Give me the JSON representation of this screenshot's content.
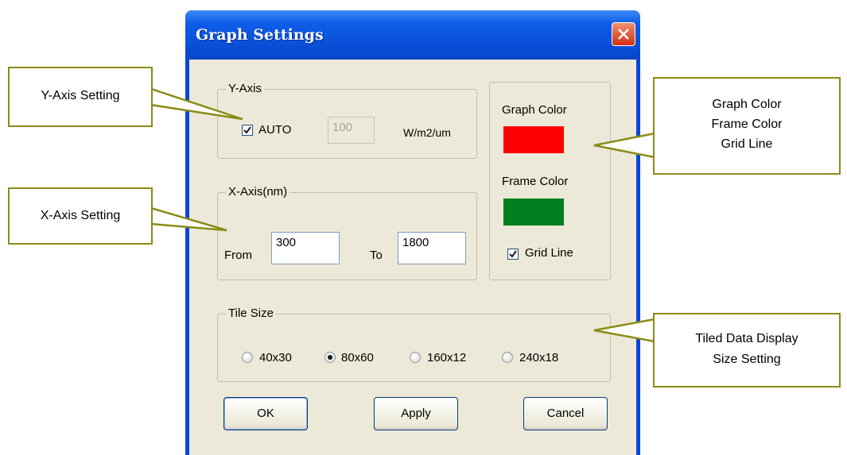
{
  "dialog": {
    "title": "Graph Settings",
    "close_icon": "close-icon"
  },
  "y_axis": {
    "legend": "Y-Axis",
    "auto_label": "AUTO",
    "auto_checked": true,
    "value": "100",
    "unit": "W/m2/um"
  },
  "x_axis": {
    "legend": "X-Axis(nm)",
    "from_label": "From",
    "from_value": "300",
    "to_label": "To",
    "to_value": "1800"
  },
  "colors": {
    "graph_color_label": "Graph Color",
    "graph_color": "#ff0000",
    "frame_color_label": "Frame Color",
    "frame_color": "#007f1e",
    "grid_line_label": "Grid Line",
    "grid_line_checked": true
  },
  "tile_size": {
    "legend": "Tile Size",
    "options": [
      "40x30",
      "80x60",
      "160x12",
      "240x18"
    ],
    "selected": "80x60"
  },
  "buttons": {
    "ok": "OK",
    "apply": "Apply",
    "cancel": "Cancel"
  },
  "callouts": {
    "y_axis": "Y-Axis Setting",
    "x_axis": "X-Axis Setting",
    "color_lines": [
      "Graph Color",
      "Frame Color",
      "Grid Line"
    ],
    "tiled_lines": [
      "Tiled Data Display",
      "Size Setting"
    ]
  }
}
